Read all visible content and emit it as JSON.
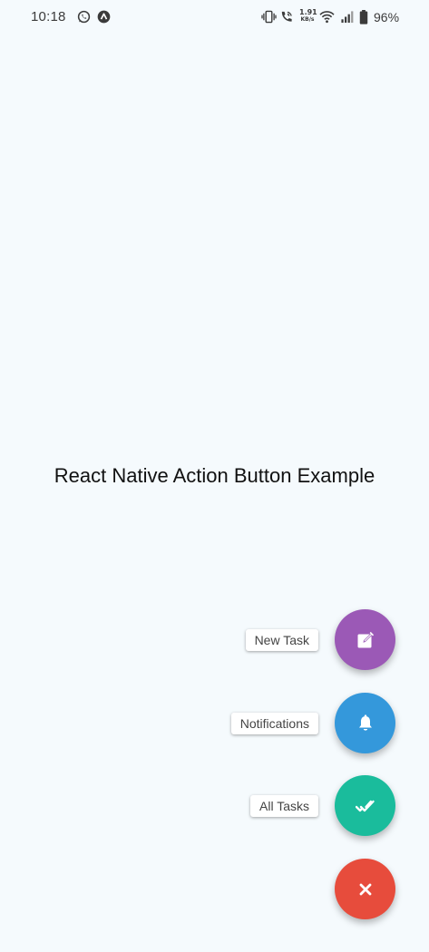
{
  "status_bar": {
    "time": "10:18",
    "net_speed_value": "1.91",
    "net_speed_unit": "KB/s",
    "battery": "96%",
    "icons_left": [
      "whatsapp-icon",
      "app-notification-icon"
    ],
    "icons_right": [
      "vibrate-icon",
      "wifi-call-icon",
      "wifi-icon",
      "signal-icon",
      "battery-icon"
    ]
  },
  "main": {
    "title": "React Native Action Button Example"
  },
  "action_button": {
    "items": [
      {
        "label": "New Task",
        "color": "#9b59b6",
        "icon": "edit-icon"
      },
      {
        "label": "Notifications",
        "color": "#3498db",
        "icon": "bell-icon"
      },
      {
        "label": "All Tasks",
        "color": "#1abc9c",
        "icon": "double-check-icon"
      }
    ],
    "close": {
      "color": "#e74c3c",
      "icon": "close-icon"
    }
  }
}
